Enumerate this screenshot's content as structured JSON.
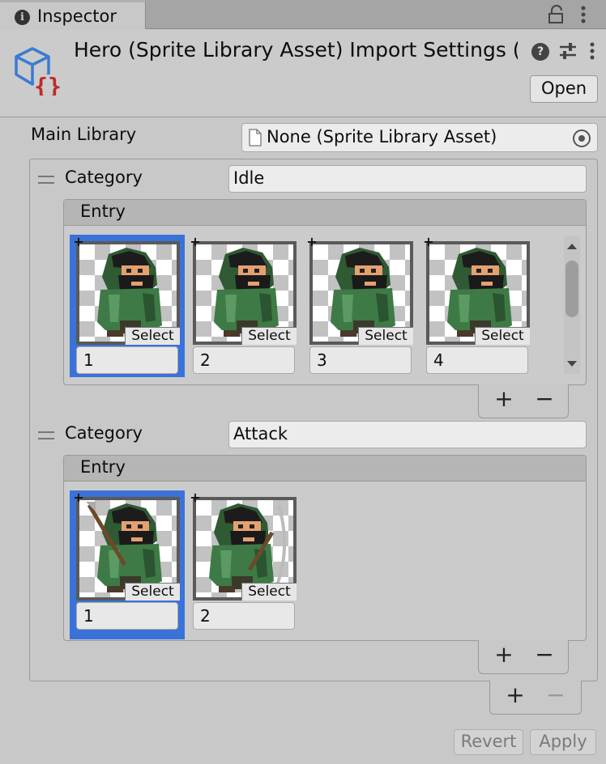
{
  "tab": {
    "title": "Inspector",
    "info_icon": "i",
    "icons": [
      "info-icon",
      "lock-icon",
      "kebab-menu-icon"
    ]
  },
  "header": {
    "title": "Hero (Sprite Library Asset) Import Settings (",
    "open_label": "Open",
    "help_glyph": "?",
    "icons": [
      "sprite-library-asset-icon",
      "help-icon",
      "presets-icon",
      "kebab-menu-icon"
    ]
  },
  "main_library": {
    "label": "Main Library",
    "value": "None (Sprite Library Asset)"
  },
  "categories": [
    {
      "label": "Category",
      "name": "Idle",
      "entry_header": "Entry",
      "entries": [
        {
          "name": "1",
          "select_label": "Select",
          "selected": true
        },
        {
          "name": "2",
          "select_label": "Select",
          "selected": false
        },
        {
          "name": "3",
          "select_label": "Select",
          "selected": false
        },
        {
          "name": "4",
          "select_label": "Select",
          "selected": false
        }
      ],
      "add_glyph": "+",
      "remove_glyph": "−"
    },
    {
      "label": "Category",
      "name": "Attack",
      "entry_header": "Entry",
      "entries": [
        {
          "name": "1",
          "select_label": "Select",
          "selected": true
        },
        {
          "name": "2",
          "select_label": "Select",
          "selected": false
        }
      ],
      "add_glyph": "+",
      "remove_glyph": "−"
    }
  ],
  "list_footer": {
    "add_glyph": "+",
    "remove_glyph": "−"
  },
  "actions": {
    "revert_label": "Revert",
    "apply_label": "Apply"
  },
  "plus_badge": "+",
  "colors": {
    "selection": "#3a72d9",
    "icon_blue": "#3a7bd5",
    "icon_red": "#c0282d"
  }
}
